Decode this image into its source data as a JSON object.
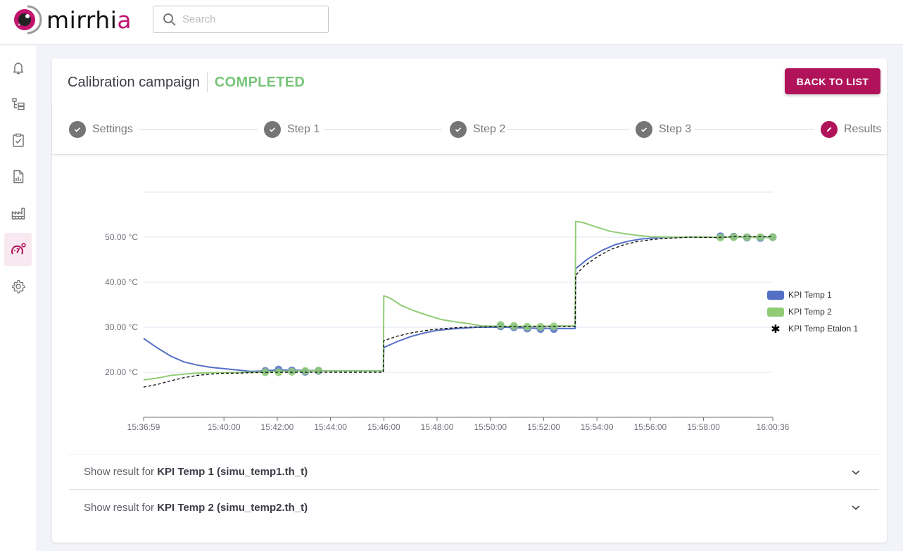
{
  "app": {
    "logo_text_main": "mirrhi",
    "logo_text_accent": "a",
    "search_placeholder": "Search"
  },
  "sidebar": {
    "items": [
      {
        "name": "notifications",
        "icon": "bell-icon",
        "active": false
      },
      {
        "name": "hierarchy",
        "icon": "hierarchy-icon",
        "active": false
      },
      {
        "name": "tasks",
        "icon": "clipboard-check-icon",
        "active": false
      },
      {
        "name": "reports",
        "icon": "report-chart-icon",
        "active": false
      },
      {
        "name": "factory",
        "icon": "factory-icon",
        "active": false
      },
      {
        "name": "calibration",
        "icon": "gauge-icon",
        "active": true
      },
      {
        "name": "settings",
        "icon": "gear-icon",
        "active": false
      }
    ]
  },
  "header": {
    "title": "Calibration campaign",
    "status": "COMPLETED",
    "status_color": "#78c47a",
    "back_button": "BACK TO LIST",
    "accent_color": "#b0135a"
  },
  "stepper": {
    "steps": [
      {
        "label": "Settings",
        "state": "done"
      },
      {
        "label": "Step 1",
        "state": "done"
      },
      {
        "label": "Step 2",
        "state": "done"
      },
      {
        "label": "Step 3",
        "state": "done"
      },
      {
        "label": "Results",
        "state": "active"
      }
    ]
  },
  "chart_data": {
    "type": "line",
    "title": "",
    "xlabel": "",
    "ylabel": "",
    "x_unit": "time",
    "x_range": [
      "15:36:59",
      "16:00:36"
    ],
    "ylim": [
      10,
      60
    ],
    "y_ticks": [
      {
        "value": 20,
        "label": "20.00 °C"
      },
      {
        "value": 30,
        "label": "30.00 °C"
      },
      {
        "value": 40,
        "label": "40.00 °C"
      },
      {
        "value": 50,
        "label": "50.00 °C"
      }
    ],
    "y_grid": [
      20,
      30,
      40,
      50,
      60
    ],
    "x_ticks": [
      "15:36:59",
      "15:40:00",
      "15:42:00",
      "15:44:00",
      "15:46:00",
      "15:48:00",
      "15:50:00",
      "15:52:00",
      "15:54:00",
      "15:56:00",
      "15:58:00",
      "16:00:36"
    ],
    "legend_position": "right",
    "series": [
      {
        "name": "KPI Temp 1",
        "color": "#5470c6",
        "style": "solid",
        "points": [
          [
            "15:36:59",
            27.5
          ],
          [
            "15:37:30",
            25.4
          ],
          [
            "15:38:00",
            23.6
          ],
          [
            "15:38:30",
            22.3
          ],
          [
            "15:39:00",
            21.6
          ],
          [
            "15:39:30",
            21.1
          ],
          [
            "15:40:00",
            20.8
          ],
          [
            "15:40:30",
            20.5
          ],
          [
            "15:41:00",
            20.2
          ],
          [
            "15:41:30",
            20.3
          ],
          [
            "15:42:00",
            20.5
          ],
          [
            "15:43:00",
            20.4
          ],
          [
            "15:44:00",
            20.3
          ],
          [
            "15:45:59",
            20.3
          ],
          [
            "15:46:00",
            25.5
          ],
          [
            "15:46:30",
            26.8
          ],
          [
            "15:47:00",
            27.9
          ],
          [
            "15:47:30",
            28.7
          ],
          [
            "15:48:00",
            29.3
          ],
          [
            "15:48:30",
            29.6
          ],
          [
            "15:49:00",
            29.8
          ],
          [
            "15:49:30",
            30.0
          ],
          [
            "15:50:30",
            30.0
          ],
          [
            "15:51:30",
            29.8
          ],
          [
            "15:52:30",
            29.7
          ],
          [
            "15:53:11",
            29.7
          ],
          [
            "15:53:12",
            43.0
          ],
          [
            "15:53:40",
            45.2
          ],
          [
            "15:54:10",
            47.0
          ],
          [
            "15:54:40",
            48.3
          ],
          [
            "15:55:10",
            49.1
          ],
          [
            "15:55:40",
            49.6
          ],
          [
            "15:56:20",
            49.9
          ],
          [
            "15:57:00",
            50.0
          ],
          [
            "15:58:00",
            50.0
          ],
          [
            "15:59:00",
            50.0
          ],
          [
            "16:00:36",
            50.0
          ]
        ],
        "markers": [
          [
            "15:41:33",
            20.3
          ],
          [
            "15:42:03",
            20.6
          ],
          [
            "15:42:33",
            20.4
          ],
          [
            "15:43:03",
            20.1
          ],
          [
            "15:43:33",
            20.3
          ],
          [
            "15:50:23",
            30.2
          ],
          [
            "15:50:53",
            30.0
          ],
          [
            "15:51:23",
            29.7
          ],
          [
            "15:51:53",
            29.6
          ],
          [
            "15:52:23",
            29.6
          ],
          [
            "15:58:38",
            50.2
          ],
          [
            "15:59:08",
            50.1
          ],
          [
            "15:59:38",
            49.9
          ],
          [
            "16:00:08",
            49.8
          ],
          [
            "16:00:36",
            50.0
          ]
        ]
      },
      {
        "name": "KPI Temp 2",
        "color": "#91cc75",
        "style": "solid",
        "points": [
          [
            "15:36:59",
            18.3
          ],
          [
            "15:37:30",
            18.7
          ],
          [
            "15:38:00",
            19.3
          ],
          [
            "15:38:30",
            19.6
          ],
          [
            "15:39:00",
            19.8
          ],
          [
            "15:39:30",
            19.9
          ],
          [
            "15:40:00",
            19.9
          ],
          [
            "15:41:00",
            20.0
          ],
          [
            "15:42:00",
            20.2
          ],
          [
            "15:43:00",
            20.3
          ],
          [
            "15:44:00",
            20.3
          ],
          [
            "15:45:59",
            20.3
          ],
          [
            "15:46:00",
            37.0
          ],
          [
            "15:46:15",
            36.4
          ],
          [
            "15:46:40",
            34.8
          ],
          [
            "15:47:10",
            33.6
          ],
          [
            "15:47:40",
            32.6
          ],
          [
            "15:48:10",
            31.7
          ],
          [
            "15:48:40",
            31.2
          ],
          [
            "15:49:10",
            30.8
          ],
          [
            "15:49:40",
            30.3
          ],
          [
            "15:50:30",
            30.2
          ],
          [
            "15:51:30",
            30.2
          ],
          [
            "15:52:30",
            30.3
          ],
          [
            "15:53:11",
            30.3
          ],
          [
            "15:53:12",
            53.5
          ],
          [
            "15:53:30",
            53.2
          ],
          [
            "15:54:00",
            52.2
          ],
          [
            "15:54:30",
            51.3
          ],
          [
            "15:55:00",
            50.8
          ],
          [
            "15:55:30",
            50.4
          ],
          [
            "15:56:00",
            50.1
          ],
          [
            "15:57:00",
            50.0
          ],
          [
            "15:58:00",
            50.0
          ],
          [
            "15:59:00",
            50.0
          ],
          [
            "16:00:36",
            49.9
          ]
        ],
        "markers": [
          [
            "15:41:33",
            20.0
          ],
          [
            "15:42:03",
            20.0
          ],
          [
            "15:42:33",
            20.1
          ],
          [
            "15:43:03",
            20.3
          ],
          [
            "15:43:33",
            20.4
          ],
          [
            "15:50:23",
            30.5
          ],
          [
            "15:50:53",
            30.3
          ],
          [
            "15:51:23",
            30.1
          ],
          [
            "15:51:53",
            30.1
          ],
          [
            "15:52:23",
            30.2
          ],
          [
            "15:58:38",
            49.9
          ],
          [
            "15:59:08",
            50.0
          ],
          [
            "15:59:38",
            50.0
          ],
          [
            "16:00:08",
            50.0
          ],
          [
            "16:00:36",
            50.0
          ]
        ]
      },
      {
        "name": "KPI Temp Etalon 1",
        "color": "#111111",
        "style": "dashed",
        "points": [
          [
            "15:36:59",
            16.7
          ],
          [
            "15:37:30",
            17.3
          ],
          [
            "15:38:00",
            18.1
          ],
          [
            "15:38:30",
            18.8
          ],
          [
            "15:39:00",
            19.3
          ],
          [
            "15:39:30",
            19.6
          ],
          [
            "15:40:00",
            19.8
          ],
          [
            "15:40:30",
            19.8
          ],
          [
            "15:41:00",
            19.9
          ],
          [
            "15:42:00",
            20.0
          ],
          [
            "15:43:00",
            20.0
          ],
          [
            "15:44:00",
            20.0
          ],
          [
            "15:45:59",
            20.0
          ],
          [
            "15:46:00",
            27.0
          ],
          [
            "15:46:30",
            28.0
          ],
          [
            "15:47:00",
            28.7
          ],
          [
            "15:47:30",
            29.2
          ],
          [
            "15:48:00",
            29.6
          ],
          [
            "15:48:30",
            29.8
          ],
          [
            "15:49:00",
            30.0
          ],
          [
            "15:50:00",
            30.1
          ],
          [
            "15:51:00",
            30.1
          ],
          [
            "15:52:00",
            30.2
          ],
          [
            "15:53:11",
            30.2
          ],
          [
            "15:53:12",
            41.5
          ],
          [
            "15:53:30",
            43.5
          ],
          [
            "15:54:00",
            45.6
          ],
          [
            "15:54:30",
            47.2
          ],
          [
            "15:55:00",
            48.3
          ],
          [
            "15:55:30",
            49.0
          ],
          [
            "15:56:00",
            49.4
          ],
          [
            "15:56:30",
            49.7
          ],
          [
            "15:57:30",
            50.0
          ],
          [
            "15:58:30",
            49.9
          ],
          [
            "15:59:30",
            50.2
          ],
          [
            "16:00:36",
            50.1
          ]
        ],
        "markers": []
      }
    ]
  },
  "results": [
    {
      "prefix": "Show result for ",
      "kpi": "KPI Temp 1 (simu_temp1.th_t)"
    },
    {
      "prefix": "Show result for ",
      "kpi": "KPI Temp 2 (simu_temp2.th_t)"
    }
  ]
}
